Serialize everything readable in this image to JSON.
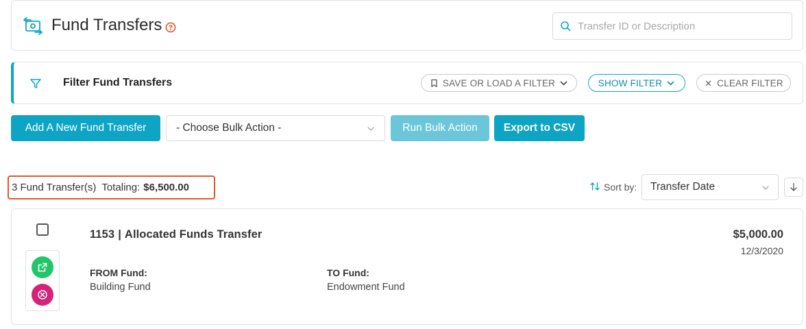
{
  "header": {
    "title": "Fund Transfers",
    "search": {
      "placeholder": "Transfer ID or Description",
      "value": ""
    }
  },
  "filter": {
    "title": "Filter Fund Transfers",
    "save_load_label": "SAVE OR LOAD A FILTER",
    "show_label": "SHOW FILTER",
    "clear_label": "CLEAR FILTER"
  },
  "actions": {
    "add_label": "Add A New Fund Transfer",
    "bulk_action_selected": "- Choose Bulk Action -",
    "run_bulk_label": "Run Bulk Action",
    "export_label": "Export to CSV"
  },
  "summary": {
    "count_text": "3 Fund Transfer(s)",
    "totaling_label": "Totaling:",
    "total_amount": "$6,500.00"
  },
  "sort": {
    "label": "Sort by:",
    "selected": "Transfer Date"
  },
  "transfers": [
    {
      "id": "1153",
      "separator": "|",
      "description": "Allocated Funds Transfer",
      "amount": "$5,000.00",
      "date": "12/3/2020",
      "from_label": "FROM Fund:",
      "from_fund": "Building Fund",
      "to_label": "TO Fund:",
      "to_fund": "Endowment Fund"
    }
  ],
  "colors": {
    "accent": "#0ea5c4",
    "highlight_border": "#e4572e",
    "open_button": "#22c56a",
    "remove_button": "#d6237a",
    "help_icon": "#e4572e"
  }
}
